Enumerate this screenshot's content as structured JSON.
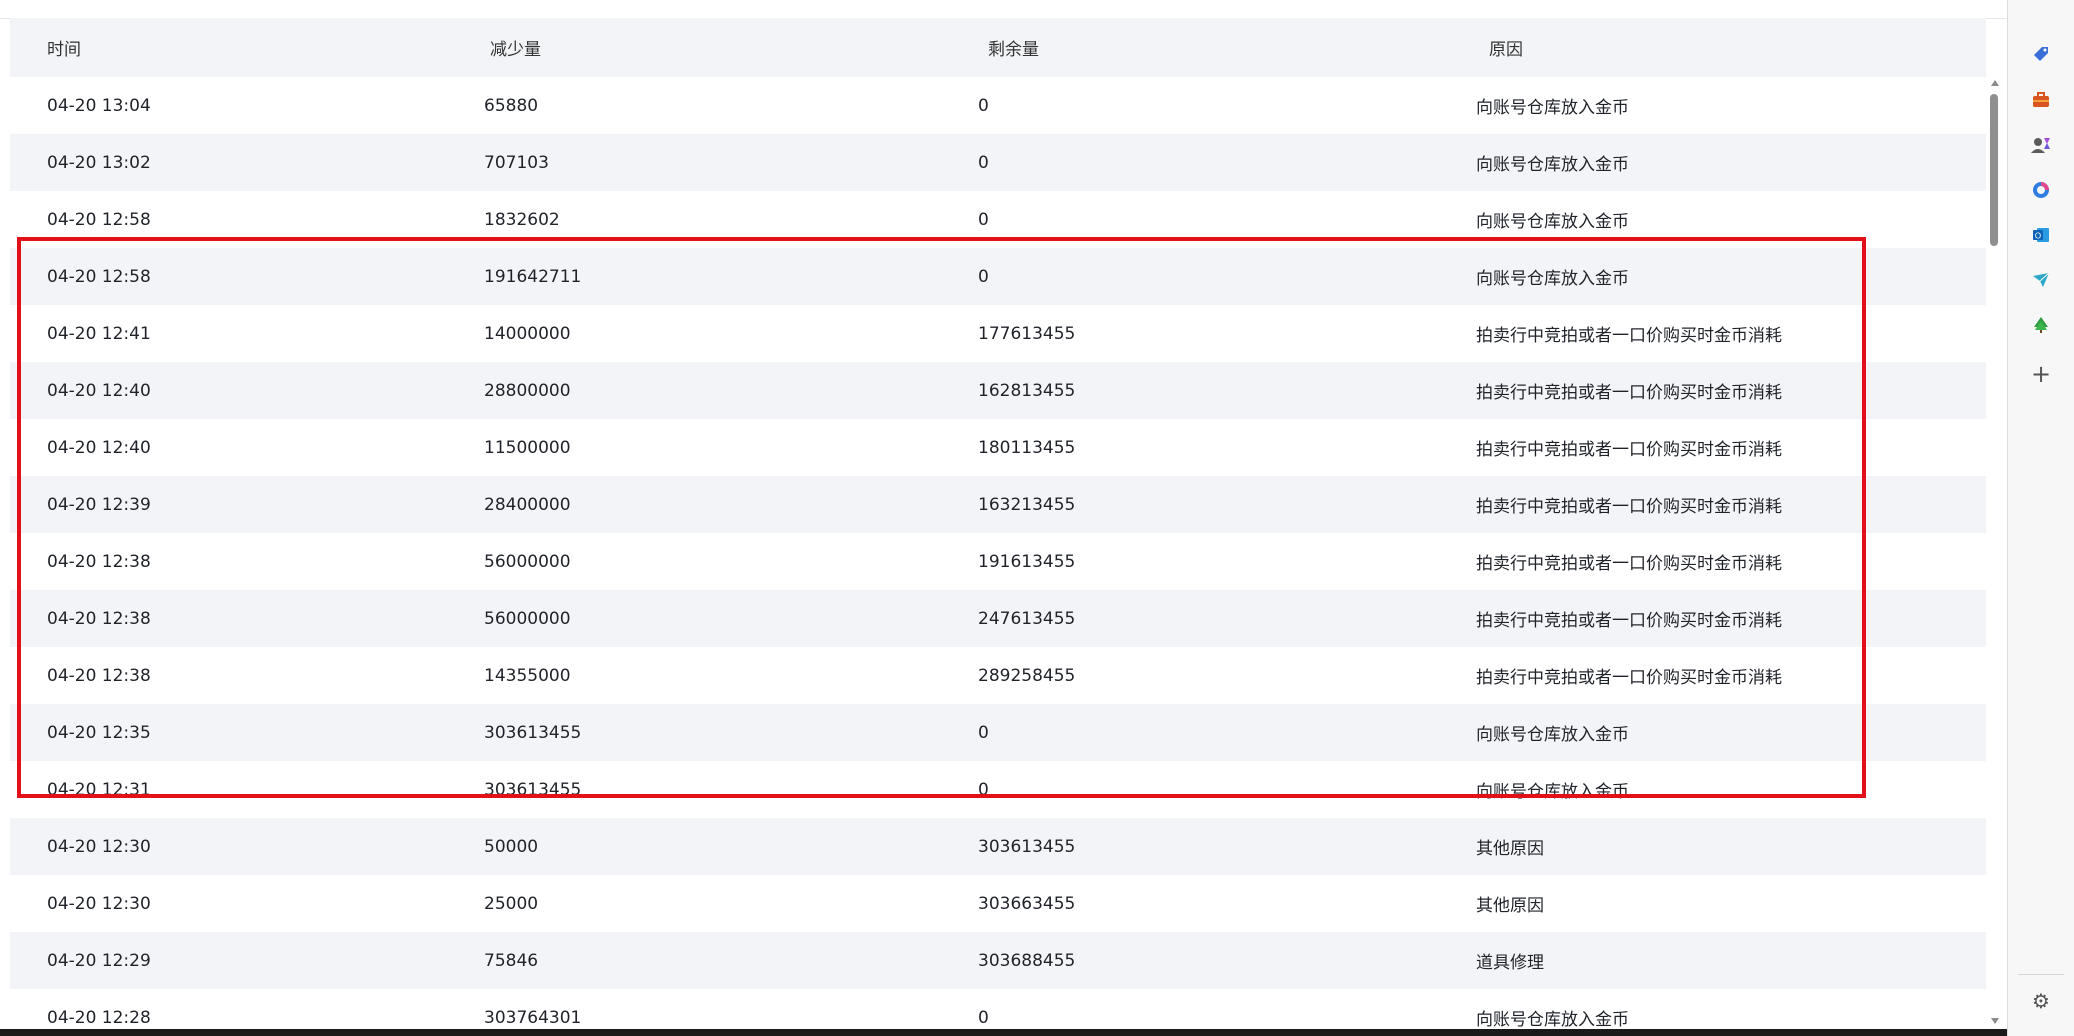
{
  "table": {
    "headers": [
      "时间",
      "减少量",
      "剩余量",
      "原因"
    ],
    "rows": [
      {
        "time": "04-20 13:04",
        "decrease": "65880",
        "remaining": "0",
        "reason": "向账号仓库放入金币"
      },
      {
        "time": "04-20 13:02",
        "decrease": "707103",
        "remaining": "0",
        "reason": "向账号仓库放入金币"
      },
      {
        "time": "04-20 12:58",
        "decrease": "1832602",
        "remaining": "0",
        "reason": "向账号仓库放入金币"
      },
      {
        "time": "04-20 12:58",
        "decrease": "191642711",
        "remaining": "0",
        "reason": "向账号仓库放入金币"
      },
      {
        "time": "04-20 12:41",
        "decrease": "14000000",
        "remaining": "177613455",
        "reason": "拍卖行中竞拍或者一口价购买时金币消耗"
      },
      {
        "time": "04-20 12:40",
        "decrease": "28800000",
        "remaining": "162813455",
        "reason": "拍卖行中竞拍或者一口价购买时金币消耗"
      },
      {
        "time": "04-20 12:40",
        "decrease": "11500000",
        "remaining": "180113455",
        "reason": "拍卖行中竞拍或者一口价购买时金币消耗"
      },
      {
        "time": "04-20 12:39",
        "decrease": "28400000",
        "remaining": "163213455",
        "reason": "拍卖行中竞拍或者一口价购买时金币消耗"
      },
      {
        "time": "04-20 12:38",
        "decrease": "56000000",
        "remaining": "191613455",
        "reason": "拍卖行中竞拍或者一口价购买时金币消耗"
      },
      {
        "time": "04-20 12:38",
        "decrease": "56000000",
        "remaining": "247613455",
        "reason": "拍卖行中竞拍或者一口价购买时金币消耗"
      },
      {
        "time": "04-20 12:38",
        "decrease": "14355000",
        "remaining": "289258455",
        "reason": "拍卖行中竞拍或者一口价购买时金币消耗"
      },
      {
        "time": "04-20 12:35",
        "decrease": "303613455",
        "remaining": "0",
        "reason": "向账号仓库放入金币"
      },
      {
        "time": "04-20 12:31",
        "decrease": "303613455",
        "remaining": "0",
        "reason": "向账号仓库放入金币"
      },
      {
        "time": "04-20 12:30",
        "decrease": "50000",
        "remaining": "303613455",
        "reason": "其他原因"
      },
      {
        "time": "04-20 12:30",
        "decrease": "25000",
        "remaining": "303663455",
        "reason": "其他原因"
      },
      {
        "time": "04-20 12:29",
        "decrease": "75846",
        "remaining": "303688455",
        "reason": "道具修理"
      },
      {
        "time": "04-20 12:28",
        "decrease": "303764301",
        "remaining": "0",
        "reason": "向账号仓库放入金币"
      }
    ]
  },
  "highlight": {
    "color": "#e3101a"
  },
  "sidebar_icons": [
    "tag-icon",
    "briefcase-icon",
    "people-icon",
    "copilot-icon",
    "outlook-icon",
    "send-icon",
    "tree-icon"
  ],
  "colors": {
    "row_alt": "#f3f4f8",
    "header_bg": "#f3f4f8"
  }
}
